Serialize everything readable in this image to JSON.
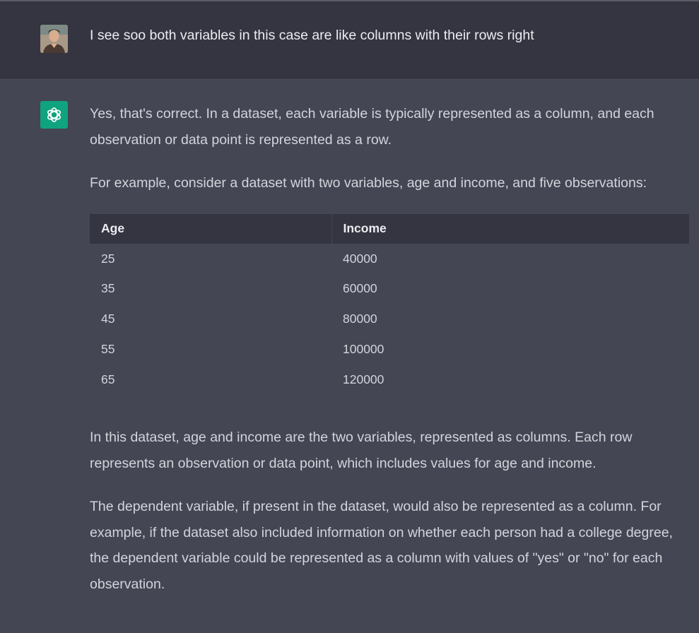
{
  "user_message": {
    "text": "I see soo both variables in this case are like columns with their rows right"
  },
  "assistant_message": {
    "paragraphs_before_table": [
      "Yes, that's correct. In a dataset, each variable is typically represented as a column, and each observation or data point is represented as a row.",
      "For example, consider a dataset with two variables, age and income, and five observations:"
    ],
    "table": {
      "headers": [
        "Age",
        "Income"
      ],
      "rows": [
        [
          "25",
          "40000"
        ],
        [
          "35",
          "60000"
        ],
        [
          "45",
          "80000"
        ],
        [
          "55",
          "100000"
        ],
        [
          "65",
          "120000"
        ]
      ]
    },
    "paragraphs_after_table": [
      "In this dataset, age and income are the two variables, represented as columns. Each row represents an observation or data point, which includes values for age and income.",
      "The dependent variable, if present in the dataset, would also be represented as a column. For example, if the dataset also included information on whether each person had a college degree, the dependent variable could be represented as a column with values of \"yes\" or \"no\" for each observation."
    ]
  },
  "icons": {
    "user_avatar": "user-photo-avatar",
    "assistant_avatar": "openai-logo-icon"
  },
  "colors": {
    "user_bg": "#343541",
    "assistant_bg": "#444654",
    "logo_bg": "#10a37f",
    "table_header_bg": "#343541"
  }
}
